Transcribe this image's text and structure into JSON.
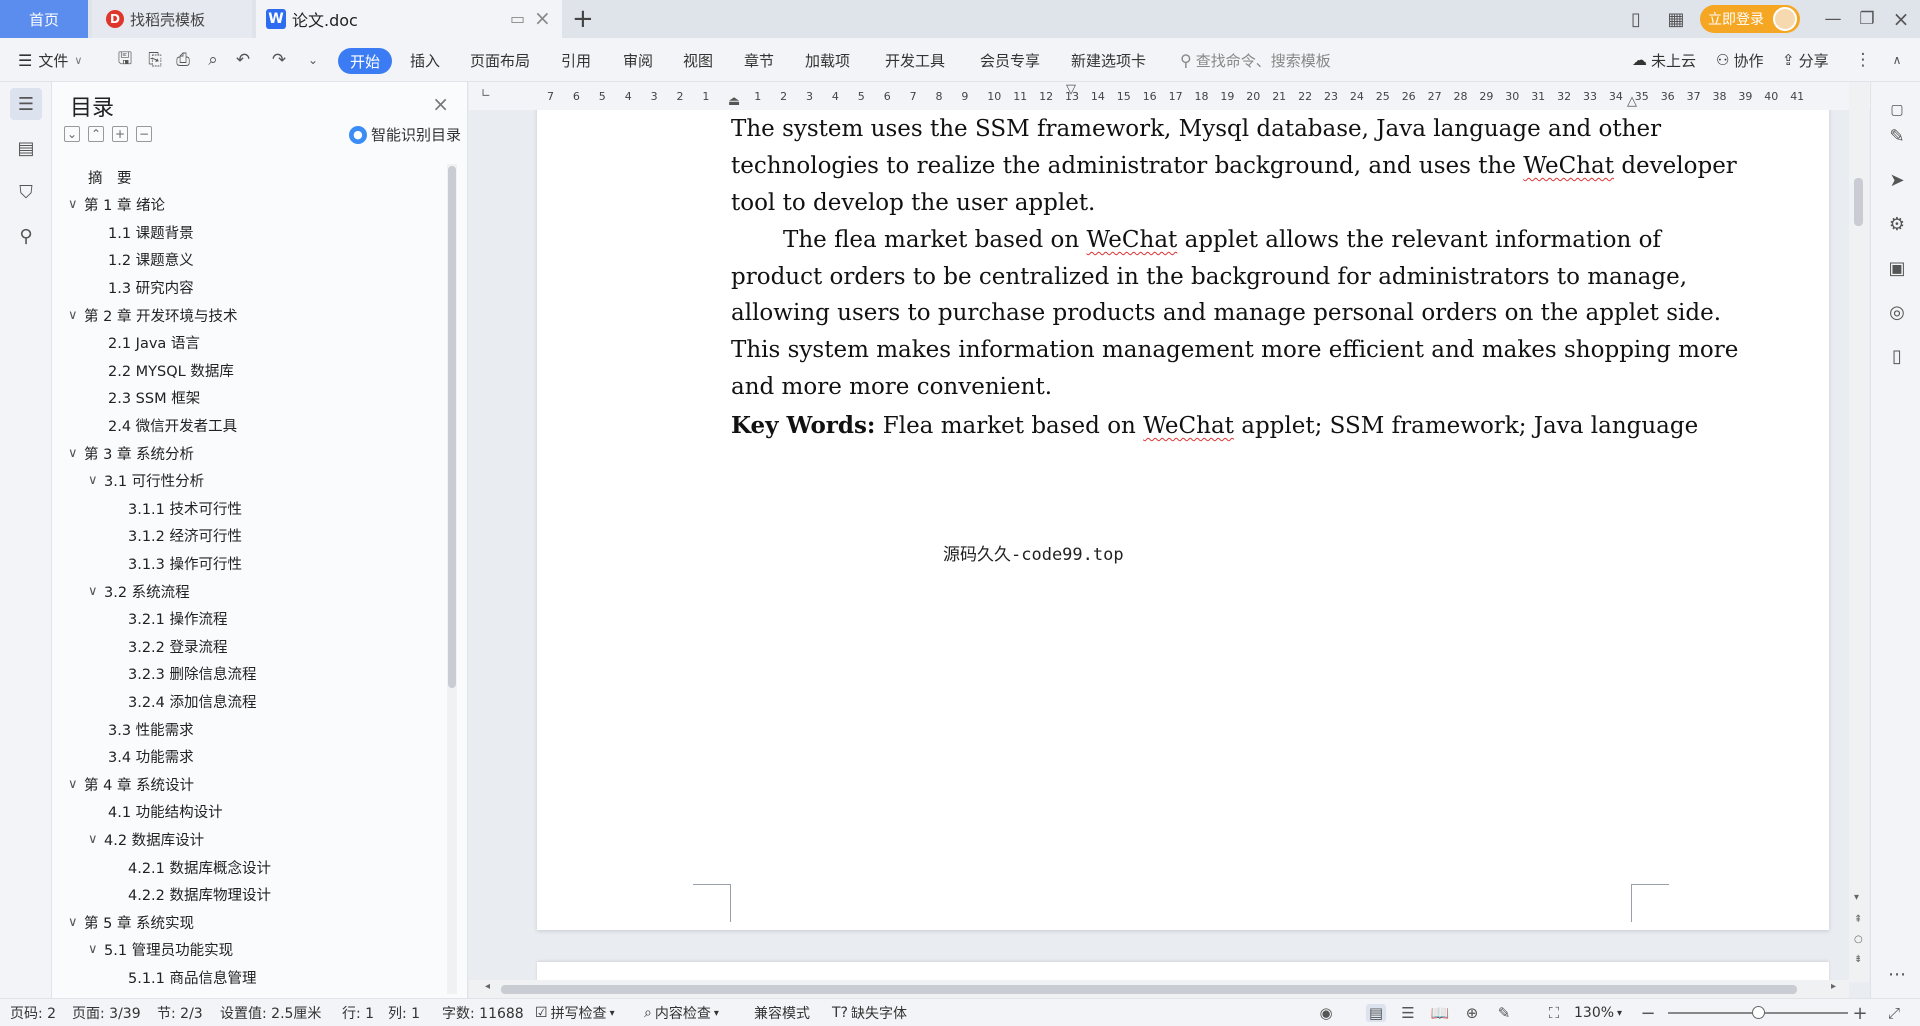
{
  "tabs": {
    "home": "首页",
    "templates": "找稻壳模板",
    "doc": "论文.doc",
    "new_tab": "+"
  },
  "top_right": {
    "login": "立即登录"
  },
  "ribbon": {
    "file": "文件",
    "start": "开始",
    "items": [
      "插入",
      "页面布局",
      "引用",
      "审阅",
      "视图",
      "章节",
      "加载项",
      "开发工具",
      "会员专享",
      "新建选项卡"
    ],
    "search_placeholder": "查找命令、搜索模板",
    "cloud": "未上云",
    "collab": "协作",
    "share": "分享"
  },
  "toc": {
    "title": "目录",
    "smart": "智能识别目录",
    "items": [
      {
        "level": 0,
        "arrow": false,
        "text": "摘　要"
      },
      {
        "level": 0,
        "arrow": true,
        "text": "第 1 章  绪论"
      },
      {
        "level": 1,
        "arrow": false,
        "text": "1.1  课题背景"
      },
      {
        "level": 1,
        "arrow": false,
        "text": "1.2  课题意义"
      },
      {
        "level": 1,
        "arrow": false,
        "text": "1.3  研究内容"
      },
      {
        "level": 0,
        "arrow": true,
        "text": "第 2 章  开发环境与技术"
      },
      {
        "level": 1,
        "arrow": false,
        "text": "2.1 Java 语言"
      },
      {
        "level": 1,
        "arrow": false,
        "text": "2.2 MYSQL 数据库"
      },
      {
        "level": 1,
        "arrow": false,
        "text": "2.3 SSM 框架"
      },
      {
        "level": 1,
        "arrow": false,
        "text": "2.4 微信开发者工具"
      },
      {
        "level": 0,
        "arrow": true,
        "text": "第 3 章  系统分析"
      },
      {
        "level": 1,
        "arrow": true,
        "text": "3.1  可行性分析"
      },
      {
        "level": 2,
        "arrow": false,
        "text": "3.1.1  技术可行性"
      },
      {
        "level": 2,
        "arrow": false,
        "text": "3.1.2  经济可行性"
      },
      {
        "level": 2,
        "arrow": false,
        "text": "3.1.3  操作可行性"
      },
      {
        "level": 1,
        "arrow": true,
        "text": "3.2  系统流程"
      },
      {
        "level": 2,
        "arrow": false,
        "text": "3.2.1  操作流程"
      },
      {
        "level": 2,
        "arrow": false,
        "text": "3.2.2  登录流程"
      },
      {
        "level": 2,
        "arrow": false,
        "text": "3.2.3  删除信息流程"
      },
      {
        "level": 2,
        "arrow": false,
        "text": "3.2.4  添加信息流程"
      },
      {
        "level": 1,
        "arrow": false,
        "text": "3.3  性能需求"
      },
      {
        "level": 1,
        "arrow": false,
        "text": "3.4  功能需求"
      },
      {
        "level": 0,
        "arrow": true,
        "text": "第 4 章  系统设计"
      },
      {
        "level": 1,
        "arrow": false,
        "text": "4.1  功能结构设计"
      },
      {
        "level": 1,
        "arrow": true,
        "text": "4.2  数据库设计"
      },
      {
        "level": 2,
        "arrow": false,
        "text": "4.2.1  数据库概念设计"
      },
      {
        "level": 2,
        "arrow": false,
        "text": "4.2.2  数据库物理设计"
      },
      {
        "level": 0,
        "arrow": true,
        "text": "第 5 章  系统实现"
      },
      {
        "level": 1,
        "arrow": true,
        "text": "5.1  管理员功能实现"
      },
      {
        "level": 2,
        "arrow": false,
        "text": "5.1.1  商品信息管理"
      }
    ]
  },
  "ruler": {
    "numbers": [
      "7",
      "6",
      "5",
      "4",
      "3",
      "2",
      "1",
      "",
      "1",
      "2",
      "3",
      "4",
      "5",
      "6",
      "7",
      "8",
      "9",
      "10",
      "11",
      "12",
      "13",
      "14",
      "15",
      "16",
      "17",
      "18",
      "19",
      "20",
      "21",
      "22",
      "23",
      "24",
      "25",
      "26",
      "27",
      "28",
      "29",
      "30",
      "31",
      "32",
      "33",
      "34",
      "35",
      "36",
      "37",
      "38",
      "39",
      "40",
      "41"
    ]
  },
  "document": {
    "line0": "The system uses the SSM framework, Mysql database, Java language and other",
    "line1_a": "technologies to realize the administrator background, and uses the ",
    "line1_b": "WeChat",
    "line1_c": " developer",
    "line2": "tool to develop the user applet.",
    "line3_a": "The flea market based on ",
    "line3_b": "WeChat",
    "line3_c": " applet allows the relevant information of",
    "line4": "product orders to be centralized in the background for administrators to manage,",
    "line5": "allowing users to purchase products and manage personal orders on the applet side.",
    "line6": "This system makes information management more efficient and makes shopping more",
    "line7": "and more more convenient.",
    "kw_label": "Key Words:",
    "kw_a": " Flea market based on ",
    "kw_b": "WeChat",
    "kw_c": " applet; SSM framework; Java language",
    "watermark": "源码久久-code99.top"
  },
  "status": {
    "page_code": "页码: 2",
    "page": "页面: 3/39",
    "section": "节: 2/3",
    "setting": "设置值: 2.5厘米",
    "row": "行: 1",
    "col": "列: 1",
    "words": "字数: 11688",
    "spell": "拼写检查",
    "content_check": "内容检查",
    "compat": "兼容模式",
    "missing_font": "缺失字体",
    "zoom": "130%"
  }
}
